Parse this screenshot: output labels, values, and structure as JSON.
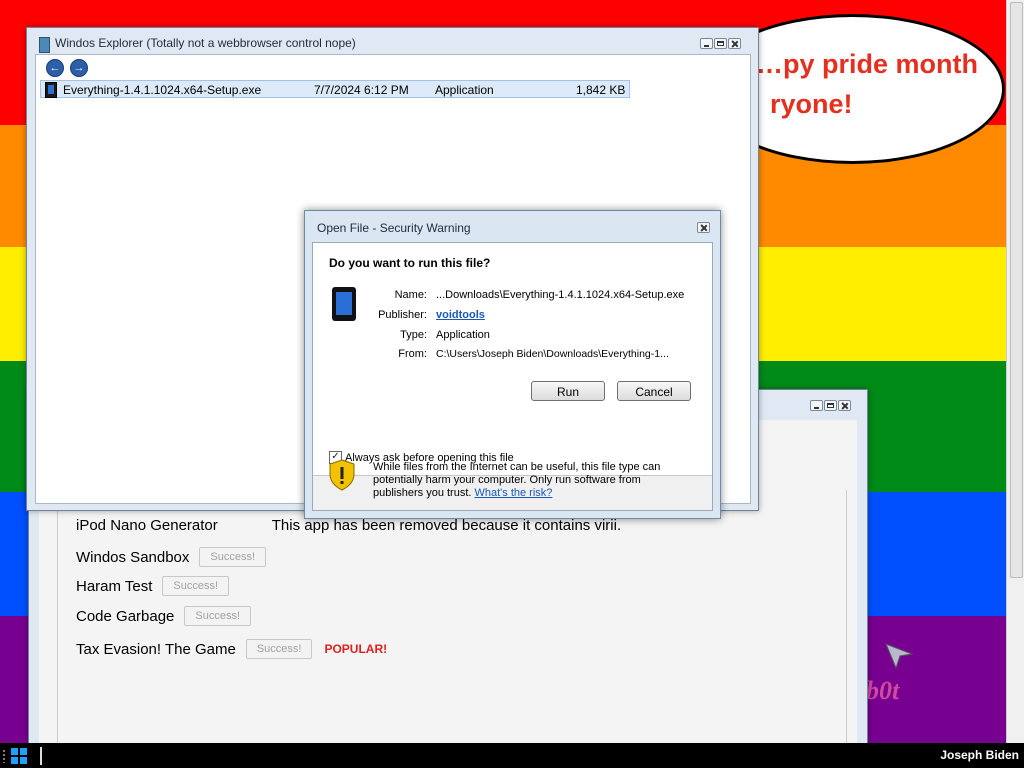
{
  "colors": {
    "stripes": [
      "#ff0000",
      "#ff8a00",
      "#ffee00",
      "#008a18",
      "#0050ff",
      "#780090"
    ],
    "bubble_text": "#e53020",
    "popular": "#e02020",
    "link": "#1858b8"
  },
  "background": {
    "bubble_line1": "…py pride month",
    "bubble_line2": "ryone!",
    "bot_text": "b0t"
  },
  "explorer": {
    "title": "Windos Explorer (Totally not a webbrowser control nope)",
    "nav": {
      "back": "←",
      "forward": "→"
    },
    "file": {
      "name": "Everything-1.4.1.1024.x64-Setup.exe",
      "date": "7/7/2024 6:12 PM",
      "type": "Application",
      "size": "1,842 KB"
    }
  },
  "apps": {
    "rows": [
      {
        "name": "iPod Nano Generator",
        "note": "This app has been removed because it contains virii."
      },
      {
        "name": "Windos Sandbox",
        "button": "Success!"
      },
      {
        "name": "Haram Test",
        "button": "Success!"
      },
      {
        "name": "Code Garbage",
        "button": "Success!"
      },
      {
        "name": "Tax Evasion! The Game",
        "button": "Success!",
        "badge": "POPULAR!"
      }
    ]
  },
  "dialog": {
    "title": "Open File - Security Warning",
    "question": "Do you want to run this file?",
    "labels": {
      "name": "Name:",
      "publisher": "Publisher:",
      "type": "Type:",
      "from": "From:"
    },
    "values": {
      "name": "...Downloads\\Everything-1.4.1.1024.x64-Setup.exe",
      "publisher": "voidtools",
      "type": "Application",
      "from": "C:\\Users\\Joseph Biden\\Downloads\\Everything-1..."
    },
    "run_label": "Run",
    "cancel_label": "Cancel",
    "checkbox_label": "Always ask before opening this file",
    "checkbox_checked": true,
    "warning_text": "While files from the Internet can be useful, this file type can potentially harm your computer. Only run software from publishers you trust.",
    "risk_link": "What's the risk?"
  },
  "taskbar": {
    "user": "Joseph Biden"
  }
}
